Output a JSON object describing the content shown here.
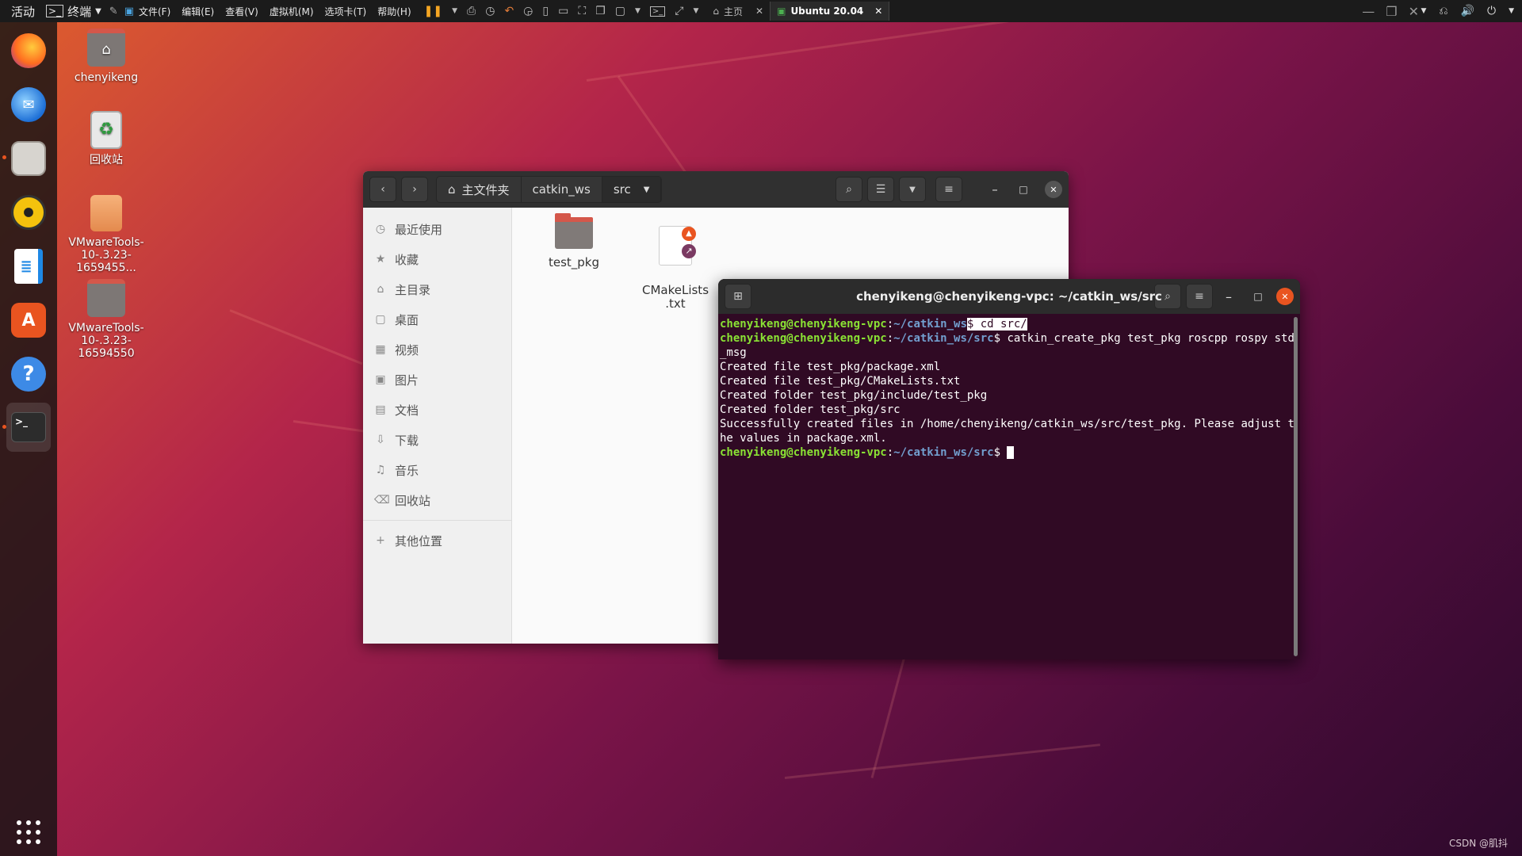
{
  "topbar": {
    "activities": "活动",
    "app_menu": "终端",
    "vm_menu": [
      "文件(F)",
      "编辑(E)",
      "查看(V)",
      "虚拟机(M)",
      "选项卡(T)",
      "帮助(H)"
    ],
    "tabs": [
      {
        "label": "主页"
      },
      {
        "label": "Ubuntu 20.04"
      }
    ]
  },
  "desktop": {
    "icons": [
      {
        "label": "chenyikeng"
      },
      {
        "label": "回收站"
      },
      {
        "label": "VMwareTools-10-.3.23-1659455..."
      },
      {
        "label": "VMwareTools-10-.3.23-16594550"
      }
    ]
  },
  "files": {
    "breadcrumbs": [
      "主文件夹",
      "catkin_ws",
      "src"
    ],
    "sidebar": [
      {
        "label": "最近使用",
        "icon": "clock-icon"
      },
      {
        "label": "收藏",
        "icon": "star-icon"
      },
      {
        "label": "主目录",
        "icon": "home-icon"
      },
      {
        "label": "桌面",
        "icon": "desktop-icon"
      },
      {
        "label": "视频",
        "icon": "video-icon"
      },
      {
        "label": "图片",
        "icon": "image-icon"
      },
      {
        "label": "文档",
        "icon": "document-icon"
      },
      {
        "label": "下载",
        "icon": "download-icon"
      },
      {
        "label": "音乐",
        "icon": "music-icon"
      },
      {
        "label": "回收站",
        "icon": "trash-icon"
      }
    ],
    "other_locations": "其他位置",
    "items": [
      {
        "name": "test_pkg",
        "type": "folder"
      },
      {
        "name": "CMakeLists\n.txt",
        "type": "file-link-locked"
      }
    ]
  },
  "terminal": {
    "title": "chenyikeng@chenyikeng-vpc: ~/catkin_ws/src",
    "prompt_user": "chenyikeng@chenyikeng-vpc",
    "line1_path": "~/catkin_ws",
    "line1_cmd": "$ cd src/",
    "line2_path": "~/catkin_ws/src",
    "line2_cmd": "$ catkin_create_pkg test_pkg roscpp rospy std_msg",
    "output": [
      "Created file test_pkg/package.xml",
      "Created file test_pkg/CMakeLists.txt",
      "Created folder test_pkg/include/test_pkg",
      "Created folder test_pkg/src",
      "Successfully created files in /home/chenyikeng/catkin_ws/src/test_pkg. Please adjust the values in package.xml."
    ],
    "line3_path": "~/catkin_ws/src",
    "line3_cmd": "$ "
  },
  "watermark": "CSDN @肌抖"
}
